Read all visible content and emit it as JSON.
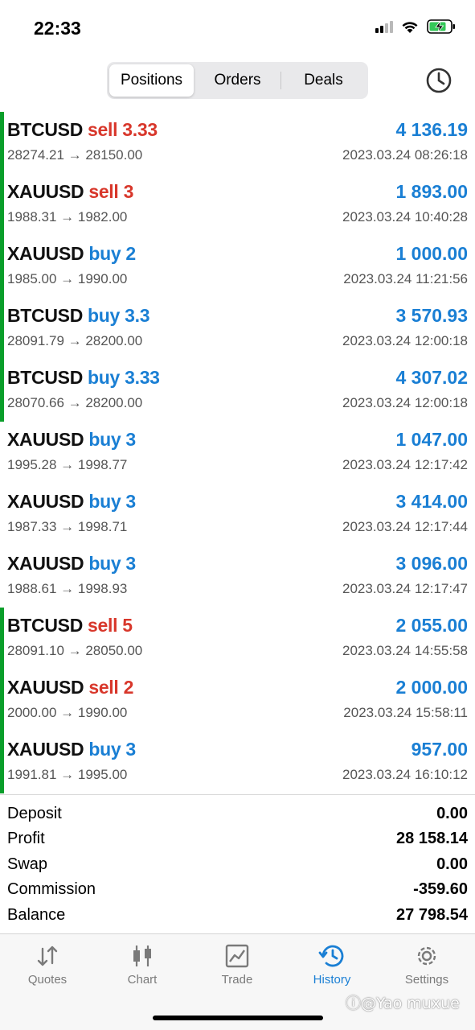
{
  "status_bar": {
    "time": "22:33"
  },
  "tabs": {
    "segments": [
      "Positions",
      "Orders",
      "Deals"
    ],
    "active": "Positions"
  },
  "deals": [
    {
      "symbol": "BTCUSD",
      "side": "sell 3.33",
      "direction": "sell",
      "prices": "28274.21 → 28150.00",
      "profit": "4 136.19",
      "time": "2023.03.24 08:26:18",
      "marked": true
    },
    {
      "symbol": "XAUUSD",
      "side": "sell 3",
      "direction": "sell",
      "prices": "1988.31 → 1982.00",
      "profit": "1 893.00",
      "time": "2023.03.24 10:40:28",
      "marked": true
    },
    {
      "symbol": "XAUUSD",
      "side": "buy 2",
      "direction": "buy",
      "prices": "1985.00 → 1990.00",
      "profit": "1 000.00",
      "time": "2023.03.24 11:21:56",
      "marked": true
    },
    {
      "symbol": "BTCUSD",
      "side": "buy 3.3",
      "direction": "buy",
      "prices": "28091.79 → 28200.00",
      "profit": "3 570.93",
      "time": "2023.03.24 12:00:18",
      "marked": true
    },
    {
      "symbol": "BTCUSD",
      "side": "buy 3.33",
      "direction": "buy",
      "prices": "28070.66 → 28200.00",
      "profit": "4 307.02",
      "time": "2023.03.24 12:00:18",
      "marked": true
    },
    {
      "symbol": "XAUUSD",
      "side": "buy 3",
      "direction": "buy",
      "prices": "1995.28 → 1998.77",
      "profit": "1 047.00",
      "time": "2023.03.24 12:17:42",
      "marked": false
    },
    {
      "symbol": "XAUUSD",
      "side": "buy 3",
      "direction": "buy",
      "prices": "1987.33 → 1998.71",
      "profit": "3 414.00",
      "time": "2023.03.24 12:17:44",
      "marked": false
    },
    {
      "symbol": "XAUUSD",
      "side": "buy 3",
      "direction": "buy",
      "prices": "1988.61 → 1998.93",
      "profit": "3 096.00",
      "time": "2023.03.24 12:17:47",
      "marked": false
    },
    {
      "symbol": "BTCUSD",
      "side": "sell 5",
      "direction": "sell",
      "prices": "28091.10 → 28050.00",
      "profit": "2 055.00",
      "time": "2023.03.24 14:55:58",
      "marked": true
    },
    {
      "symbol": "XAUUSD",
      "side": "sell 2",
      "direction": "sell",
      "prices": "2000.00 → 1990.00",
      "profit": "2 000.00",
      "time": "2023.03.24 15:58:11",
      "marked": true
    },
    {
      "symbol": "XAUUSD",
      "side": "buy 3",
      "direction": "buy",
      "prices": "1991.81 → 1995.00",
      "profit": "957.00",
      "time": "2023.03.24 16:10:12",
      "marked": true
    }
  ],
  "summary": [
    {
      "label": "Deposit",
      "value": "0.00"
    },
    {
      "label": "Profit",
      "value": "28 158.14"
    },
    {
      "label": "Swap",
      "value": "0.00"
    },
    {
      "label": "Commission",
      "value": "-359.60"
    },
    {
      "label": "Balance",
      "value": "27 798.54"
    }
  ],
  "tab_bar": [
    {
      "label": "Quotes",
      "icon": "quotes-icon",
      "active": false
    },
    {
      "label": "Chart",
      "icon": "chart-icon",
      "active": false
    },
    {
      "label": "Trade",
      "icon": "trade-icon",
      "active": false
    },
    {
      "label": "History",
      "icon": "history-icon",
      "active": true
    },
    {
      "label": "Settings",
      "icon": "settings-icon",
      "active": false
    }
  ],
  "watermark": "ⓘ@Yao muxue",
  "colors": {
    "buy": "#1a7fd4",
    "sell": "#d8372b",
    "marker": "#0a9e2a"
  }
}
